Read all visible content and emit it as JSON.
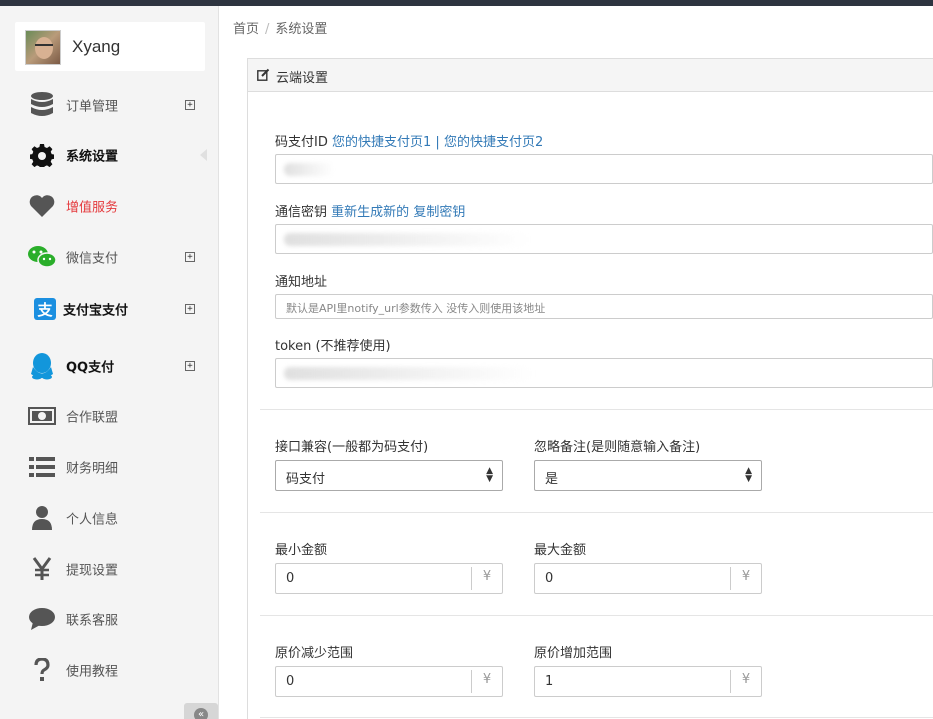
{
  "user": {
    "name": "Xyang"
  },
  "sidebar": {
    "items": [
      {
        "label": "订单管理",
        "icon": "database-icon",
        "has_expand": true,
        "style": "normal"
      },
      {
        "label": "系统设置",
        "icon": "gear-icon",
        "has_expand": false,
        "style": "bold",
        "active": true
      },
      {
        "label": "增值服务",
        "icon": "heart-icon",
        "has_expand": false,
        "style": "red"
      },
      {
        "label": "微信支付",
        "icon": "wechat-icon",
        "has_expand": true,
        "style": "normal"
      },
      {
        "label": "支付宝支付",
        "icon": "alipay-icon",
        "has_expand": true,
        "style": "bold"
      },
      {
        "label": "QQ支付",
        "icon": "qq-icon",
        "has_expand": true,
        "style": "bold"
      },
      {
        "label": "合作联盟",
        "icon": "money-icon",
        "has_expand": false,
        "style": "normal"
      },
      {
        "label": "财务明细",
        "icon": "list-icon",
        "has_expand": false,
        "style": "normal"
      },
      {
        "label": "个人信息",
        "icon": "user-icon",
        "has_expand": false,
        "style": "normal"
      },
      {
        "label": "提现设置",
        "icon": "yen-icon",
        "has_expand": false,
        "style": "normal"
      },
      {
        "label": "联系客服",
        "icon": "chat-icon",
        "has_expand": false,
        "style": "normal"
      },
      {
        "label": "使用教程",
        "icon": "question-icon",
        "has_expand": false,
        "style": "normal"
      }
    ],
    "expand_glyph": "+",
    "collapse_glyph": "«"
  },
  "breadcrumb": {
    "home": "首页",
    "separator": "/",
    "current": "系统设置"
  },
  "panel": {
    "title": "云端设置",
    "pay_id": {
      "label": "码支付ID",
      "link1": "您的快捷支付页1",
      "sep": "|",
      "link2": "您的快捷支付页2"
    },
    "secret": {
      "label": "通信密钥",
      "link1": "重新生成新的",
      "link2": "复制密钥"
    },
    "notify": {
      "label": "通知地址",
      "placeholder": "默认是API里notify_url参数传入 没传入则使用该地址"
    },
    "token": {
      "label": "token (不推荐使用)"
    },
    "compat": {
      "label": "接口兼容(一般都为码支付)",
      "value": "码支付"
    },
    "ignore_note": {
      "label": "忽略备注(是则随意输入备注)",
      "value": "是"
    },
    "min_amount": {
      "label": "最小金额",
      "value": "0",
      "unit": "¥"
    },
    "max_amount": {
      "label": "最大金额",
      "value": "0",
      "unit": "¥"
    },
    "price_decrease": {
      "label": "原价减少范围",
      "value": "0",
      "unit": "¥"
    },
    "price_increase": {
      "label": "原价增加范围",
      "value": "1",
      "unit": "¥"
    }
  },
  "colors": {
    "red_label": "#e4393c",
    "link": "#337ab7",
    "topbar": "#2e3440",
    "sidebar_bg": "#f4f4f4"
  }
}
